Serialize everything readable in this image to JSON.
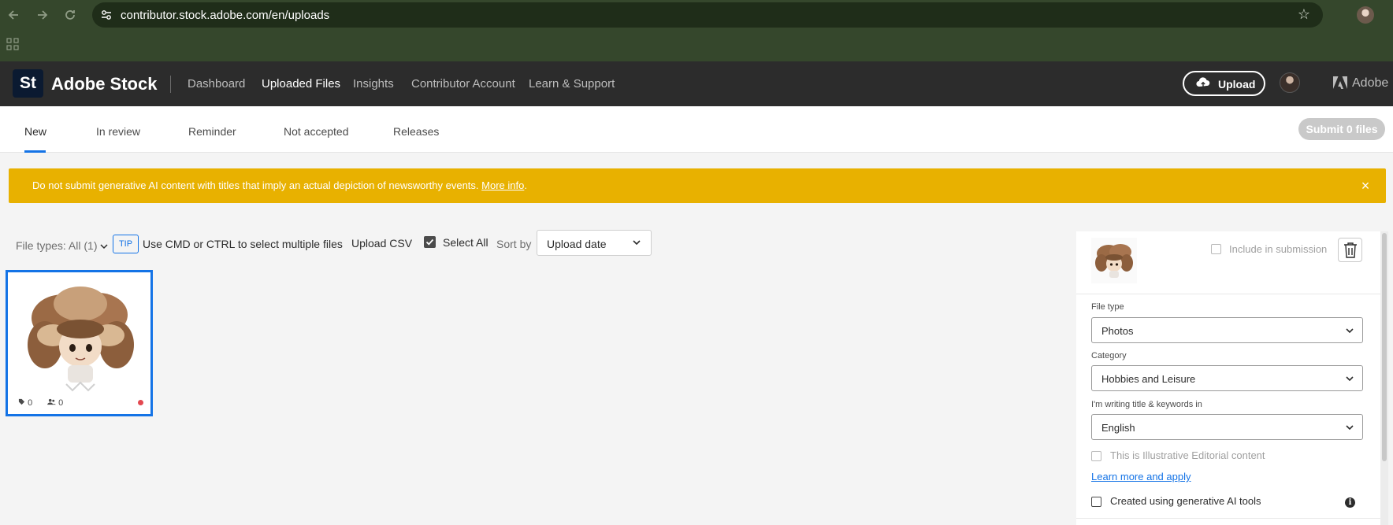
{
  "browser": {
    "url": "contributor.stock.adobe.com/en/uploads",
    "icons": [
      "back-icon",
      "forward-icon",
      "reload-icon",
      "site-info-icon",
      "bookmark-star-icon",
      "apps-grid-icon"
    ]
  },
  "header": {
    "logo_mark": "St",
    "brand": "Adobe Stock",
    "nav": [
      {
        "label": "Dashboard",
        "active": false
      },
      {
        "label": "Uploaded Files",
        "active": true
      },
      {
        "label": "Insights",
        "active": false
      },
      {
        "label": "Contributor Account",
        "active": false
      },
      {
        "label": "Learn & Support",
        "active": false
      }
    ],
    "upload_label": "Upload",
    "adobe_label": "Adobe"
  },
  "tabs": {
    "items": [
      {
        "label": "New",
        "active": true
      },
      {
        "label": "In review",
        "active": false
      },
      {
        "label": "Reminder",
        "active": false
      },
      {
        "label": "Not accepted",
        "active": false
      },
      {
        "label": "Releases",
        "active": false
      }
    ],
    "submit_label": "Submit 0 files"
  },
  "banner": {
    "message": "Do not submit generative AI content with titles that imply an actual depiction of newsworthy events.",
    "link": "More info",
    "link_suffix": ".",
    "close": "×",
    "color": "#e8b100"
  },
  "toolbar": {
    "file_types": "File types: All (1)",
    "tip_badge": "TIP",
    "tip_text": "Use CMD or CTRL to select multiple files",
    "upload_csv": "Upload CSV",
    "select_all": "Select All",
    "select_all_checked": true,
    "sort_by": "Sort by",
    "sort_value": "Upload date"
  },
  "files": [
    {
      "keywords": "0",
      "people": "0",
      "status": "incomplete",
      "selected": true
    }
  ],
  "panel": {
    "include_label": "Include in submission",
    "include_checked": false,
    "file_type_label": "File type",
    "file_type_value": "Photos",
    "category_label": "Category",
    "category_value": "Hobbies and Leisure",
    "language_label": "I'm writing title & keywords in",
    "language_value": "English",
    "editorial_label": "This is Illustrative Editorial content",
    "editorial_checked": false,
    "learn_more": "Learn more and apply",
    "ai_label": "Created using generative AI tools",
    "ai_checked": false,
    "info_glyph": "i"
  },
  "colors": {
    "accent": "#1473e6",
    "header_bg": "#2c2c2c",
    "chrome_bg": "#35472c",
    "warning": "#e8b100"
  }
}
